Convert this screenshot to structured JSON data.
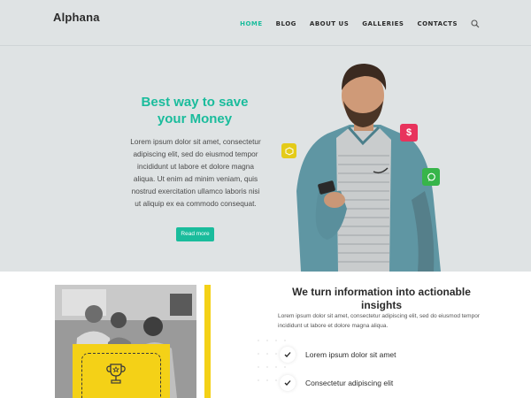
{
  "site": {
    "logo": "Alphana"
  },
  "nav": {
    "items": [
      {
        "label": "HOME",
        "active": true
      },
      {
        "label": "BLOG",
        "active": false
      },
      {
        "label": "ABOUT US",
        "active": false
      },
      {
        "label": "GALLERIES",
        "active": false
      },
      {
        "label": "CONTACTS",
        "active": false
      }
    ],
    "search_icon": "search-icon"
  },
  "hero": {
    "title": "Best way to save your Money",
    "text": "Lorem ipsum dolor sit amet, consectetur adipiscing elit, sed do eiusmod tempor incididunt ut labore et dolore magna aliqua. Ut enim ad minim veniam, quis nostrud exercitation ullamco laboris nisi ut aliquip ex ea commodo consequat.",
    "button_label": "Read more",
    "badges": [
      {
        "icon": "box-icon",
        "color": "#e4cb19"
      },
      {
        "icon": "dollar-icon",
        "glyph": "$",
        "color": "#e8335c"
      },
      {
        "icon": "chat-icon",
        "color": "#37b54a"
      }
    ]
  },
  "info": {
    "title": "We turn information into actionable insights",
    "text": "Lorem ipsum dolor sit amet, consectetur adipiscing elit, sed do eiusmod tempor incididunt ut labore et dolore magna aliqua.",
    "checklist": [
      "Lorem ipsum dolor sit amet",
      "Consectetur adipiscing elit"
    ]
  },
  "colors": {
    "accent": "#1abc9c",
    "hero_bg": "#dfe3e4",
    "yellow": "#f4d117",
    "red": "#e8335c",
    "green": "#37b54a"
  }
}
